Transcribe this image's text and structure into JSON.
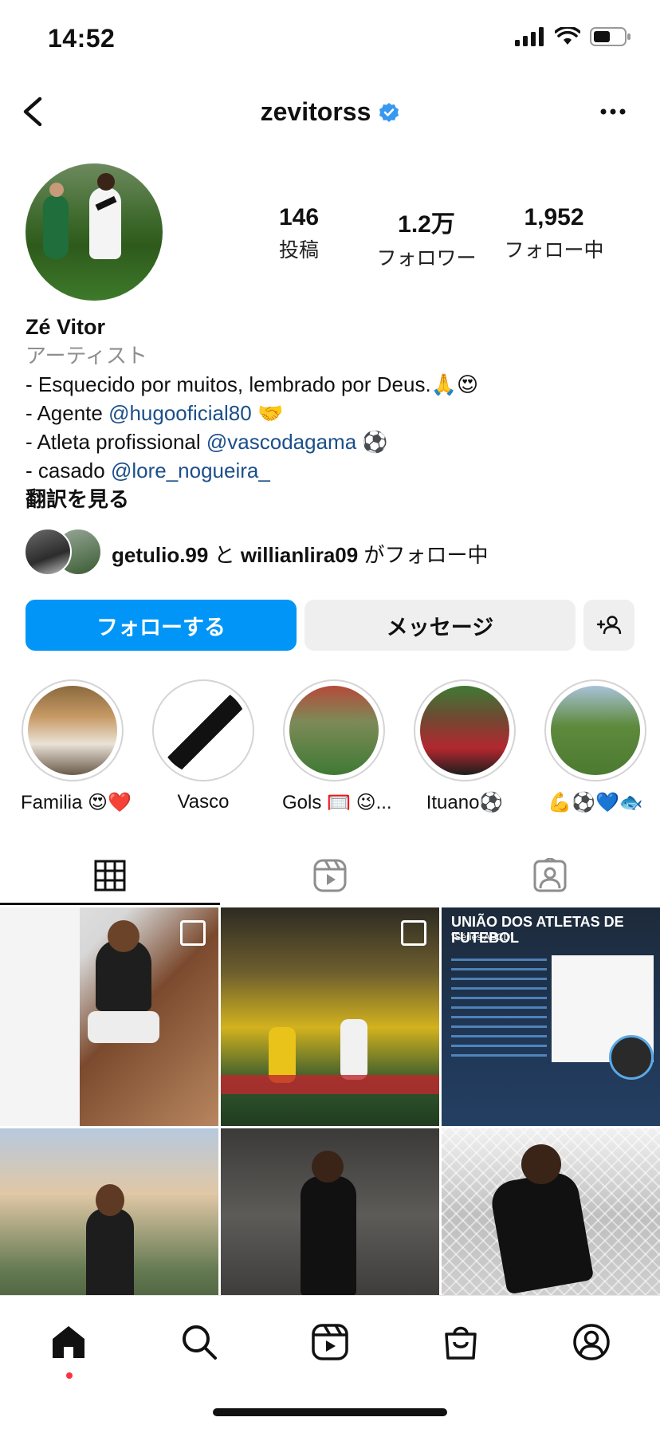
{
  "status": {
    "time": "14:52"
  },
  "header": {
    "username": "zevitorss"
  },
  "profile": {
    "stats": [
      {
        "value": "146",
        "label": "投稿"
      },
      {
        "value": "1.2万",
        "label": "フォロワー"
      },
      {
        "value": "1,952",
        "label": "フォロー中"
      }
    ],
    "name": "Zé Vitor",
    "category": "アーティスト",
    "bio": {
      "line1": "- Esquecido por muitos, lembrado por Deus.🙏😍",
      "line2_prefix": "- Agente ",
      "line2_link": "@hugooficial80",
      "line2_suffix": " 🤝",
      "line3_prefix": "- Atleta profissional ",
      "line3_link": "@vascodagama",
      "line3_suffix": " ⚽",
      "line4_prefix": "- casado ",
      "line4_link": "@lore_nogueira_"
    },
    "translate": "翻訳を見る",
    "followed_by": {
      "user1": "getulio.99",
      "connector": " と ",
      "user2": "willianlira09",
      "suffix": " がフォロー中"
    }
  },
  "buttons": {
    "follow": "フォローする",
    "message": "メッセージ"
  },
  "highlights": [
    {
      "label": "Familia 😍❤️"
    },
    {
      "label": "Vasco"
    },
    {
      "label": "Gols 🥅 😉..."
    },
    {
      "label": "Ituano⚽"
    },
    {
      "label": "💪⚽💙🐟"
    }
  ],
  "grid": {
    "poster_title": "UNIÃO DOS ATLETAS DE FUTEBOL",
    "poster_subtitle": "\"Séries ABCD\""
  },
  "colors": {
    "accent": "#0095f6",
    "link": "#1b4f8a",
    "verified": "#3897f0",
    "notification": "#ff3040"
  }
}
